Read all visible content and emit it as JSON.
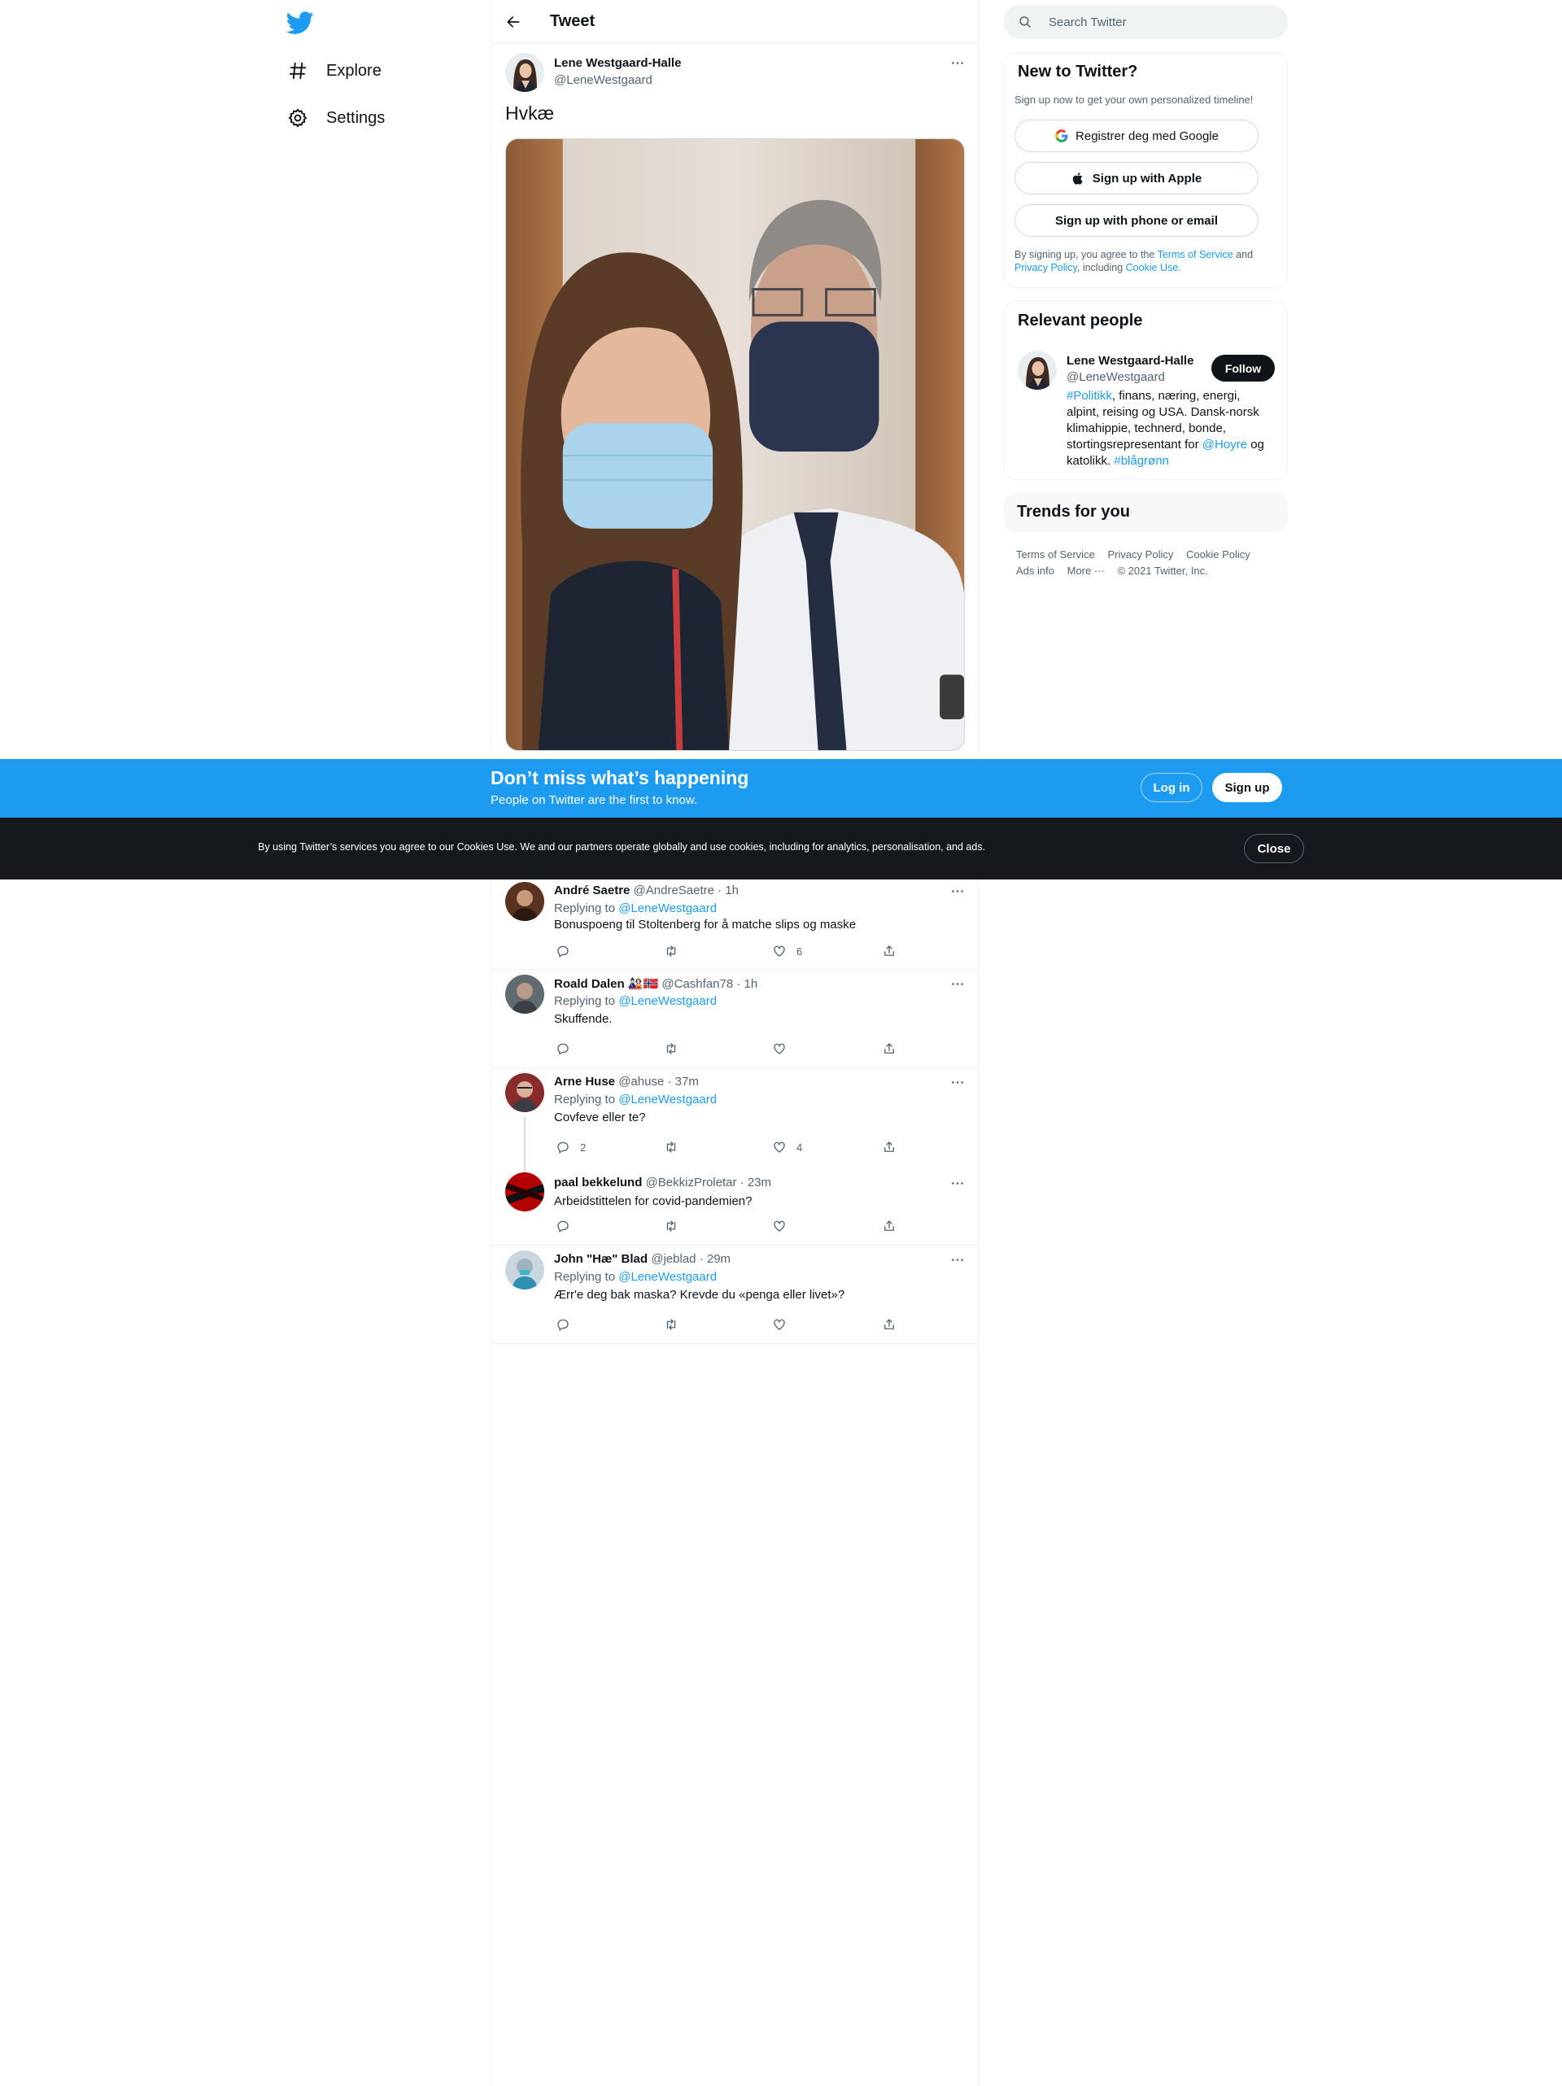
{
  "nav": {
    "logo": "twitter-bird-icon",
    "items": [
      {
        "label": "Explore",
        "icon": "hashtag-icon"
      },
      {
        "label": "Settings",
        "icon": "gear-icon"
      }
    ]
  },
  "header": {
    "title": "Tweet"
  },
  "main_tweet": {
    "name": "Lene Westgaard-Halle",
    "handle": "@LeneWestgaard",
    "text": "Hvkæ"
  },
  "replies": [
    {
      "name": "André Saetre",
      "handle": "@AndreSaetre",
      "dot": "·",
      "time": "1h",
      "replying_label": "Replying to",
      "mention": "@LeneWestgaard",
      "text": "Bonuspoeng til Stoltenberg for å matche slips og maske",
      "reply_count": "",
      "retweet_count": "",
      "like_count": "6"
    },
    {
      "name": "Roald Dalen",
      "name_emoji": "🎎🇳🇴",
      "handle": "@Cashfan78",
      "dot": "·",
      "time": "1h",
      "replying_label": "Replying to",
      "mention": "@LeneWestgaard",
      "text": "Skuffende.",
      "reply_count": "",
      "retweet_count": "",
      "like_count": ""
    },
    {
      "name": "Arne Huse",
      "handle": "@ahuse",
      "dot": "·",
      "time": "37m",
      "replying_label": "Replying to",
      "mention": "@LeneWestgaard",
      "text": "Covfeve eller te?",
      "reply_count": "2",
      "retweet_count": "",
      "like_count": "4"
    },
    {
      "name": "paal bekkelund",
      "handle": "@BekkizProletar",
      "dot": "·",
      "time": "23m",
      "text": "Arbeidstittelen for covid-pandemien?",
      "reply_count": "",
      "retweet_count": "",
      "like_count": ""
    },
    {
      "name": "John \"Hæ\" Blad",
      "handle": "@jeblad",
      "dot": "·",
      "time": "29m",
      "replying_label": "Replying to",
      "mention": "@LeneWestgaard",
      "text": "Ærr'e deg bak maska? Krevde du «penga eller livet»?",
      "reply_count": "",
      "retweet_count": "",
      "like_count": ""
    }
  ],
  "search": {
    "placeholder": "Search Twitter"
  },
  "new_to_twitter": {
    "title": "New to Twitter?",
    "subtitle": "Sign up now to get your own personalized timeline!",
    "google_button": "Registrer deg med Google",
    "apple_button": "Sign up with Apple",
    "phone_button": "Sign up with phone or email",
    "legal_1": "By signing up, you agree to the",
    "terms_link": "Terms of Service",
    "legal_2": "and",
    "privacy_link": "Privacy Policy",
    "legal_3": ", including",
    "cookie_link": "Cookie Use."
  },
  "relevant_people": {
    "title": "Relevant people",
    "name": "Lene Westgaard-Halle",
    "handle": "@LeneWestgaard",
    "follow_label": "Follow",
    "bio_tag1": "#Politikk",
    "bio_1": ", finans, næring, energi, alpint, reising og USA. Dansk-norsk klimahippie, technerd, bonde, stortingsrepresentant for",
    "bio_mention": "@Hoyre",
    "bio_2": "og katolikk.",
    "bio_tag2": "#blågrønn"
  },
  "trends": {
    "title": "Trends for you"
  },
  "footer": {
    "terms": "Terms of Service",
    "privacy": "Privacy Policy",
    "cookie": "Cookie Policy",
    "ads": "Ads info",
    "more": "More ···",
    "copyright": "© 2021 Twitter, Inc."
  },
  "banner": {
    "title": "Don’t miss what’s happening",
    "subtitle": "People on Twitter are the first to know.",
    "login": "Log in",
    "signup": "Sign up"
  },
  "cookie_bar": {
    "text_1": "By using Twitter’s services you agree to our",
    "link": "Cookies Use",
    "text_2": ". We and our partners operate globally and use cookies, including for analytics, personalisation, and ads.",
    "close": "Close"
  },
  "colors": {
    "accent": "#1d9bf0",
    "text": "#0f1419",
    "secondary": "#536471",
    "cookie_bg": "#15191e"
  }
}
